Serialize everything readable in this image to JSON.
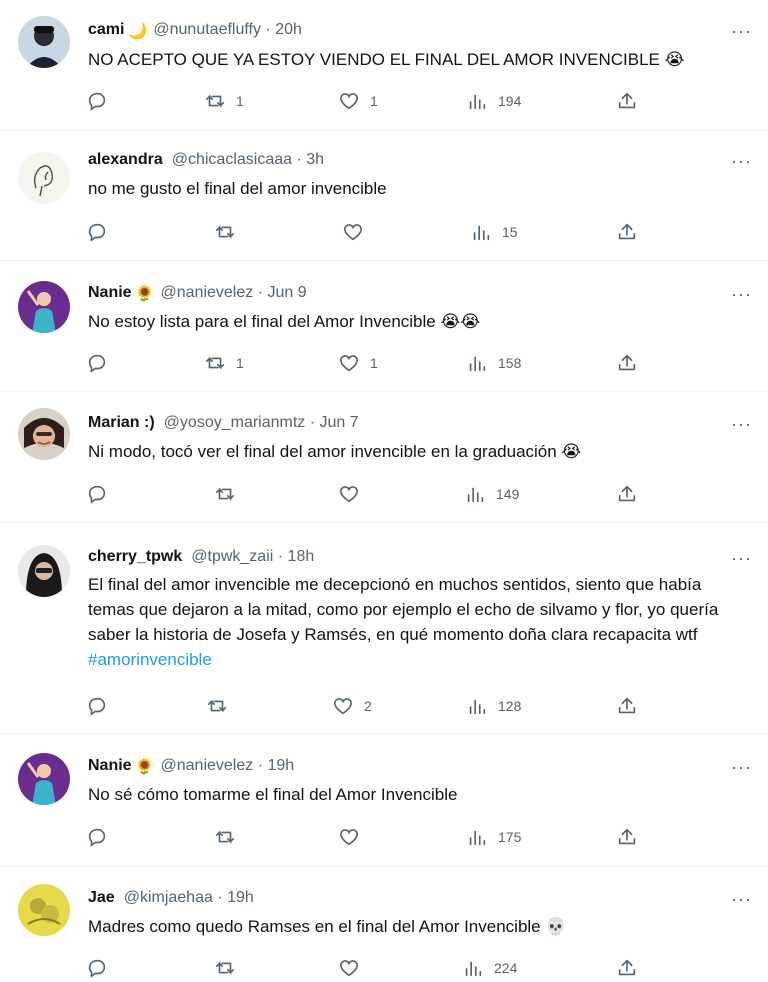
{
  "tweets": [
    {
      "name": "cami",
      "handle": "@nunutaefluffy",
      "time": "20h",
      "name_emoji": "🌙",
      "text": "NO ACEPTO QUE YA ESTOY VIENDO EL FINAL DEL AMOR INVENCIBLE 😭",
      "hashtag": "",
      "replies": "",
      "retweets": "1",
      "likes": "1",
      "views": "194",
      "avatar": "avatar-cami"
    },
    {
      "name": "alexandra",
      "handle": "@chicaclasicaaa",
      "time": "3h",
      "name_emoji": "",
      "text": "no me gusto el final del amor invencible",
      "hashtag": "",
      "replies": "",
      "retweets": "",
      "likes": "",
      "views": "15",
      "avatar": "avatar-sketch"
    },
    {
      "name": "Nanie",
      "handle": "@nanievelez",
      "time": "Jun 9",
      "name_emoji": "🌻",
      "text": "No estoy lista para el final del Amor Invencible 😭😭",
      "hashtag": "",
      "replies": "",
      "retweets": "1",
      "likes": "1",
      "views": "158",
      "avatar": "avatar-purple"
    },
    {
      "name": "Marian :)",
      "handle": "@yosoy_marianmtz",
      "time": "Jun 7",
      "name_emoji": "",
      "text": "Ni modo, tocó ver el final del amor invencible en la graduación 😭",
      "hashtag": "",
      "replies": "",
      "retweets": "",
      "likes": "",
      "views": "149",
      "avatar": "avatar-face"
    },
    {
      "name": "cherry_tpwk",
      "handle": "@tpwk_zaii",
      "time": "18h",
      "name_emoji": "",
      "text": "El final del amor invencible me decepcionó en muchos sentidos, siento que había temas que dejaron a la mitad, como por ejemplo el echo de silvamo y flor, yo quería saber la historia de Josefa y Ramsés, en qué momento doña clara recapacita wtf ",
      "hashtag": "#amorinvencible",
      "replies": "",
      "retweets": "",
      "likes": "2",
      "views": "128",
      "avatar": "avatar-dark"
    },
    {
      "name": "Nanie",
      "handle": "@nanievelez",
      "time": "19h",
      "name_emoji": "🌻",
      "text": "No sé cómo tomarme el final del Amor Invencible",
      "hashtag": "",
      "replies": "",
      "retweets": "",
      "likes": "",
      "views": "175",
      "avatar": "avatar-purple"
    },
    {
      "name": "Jae",
      "handle": "@kimjaehaa",
      "time": "19h",
      "name_emoji": "",
      "text": "Madres como quedo Ramses en el final del Amor Invencible 💀",
      "hashtag": "",
      "replies": "",
      "retweets": "",
      "likes": "",
      "views": "224",
      "avatar": "avatar-yellow"
    }
  ],
  "ui": {
    "more": "···",
    "dot": "·"
  },
  "colors": {
    "text": "#0f1419",
    "secondary": "#536471",
    "link": "#1d9bf0",
    "divider": "#eff3f4"
  },
  "icons": [
    "reply-icon",
    "retweet-icon",
    "like-icon",
    "views-icon",
    "share-icon",
    "more-icon"
  ]
}
